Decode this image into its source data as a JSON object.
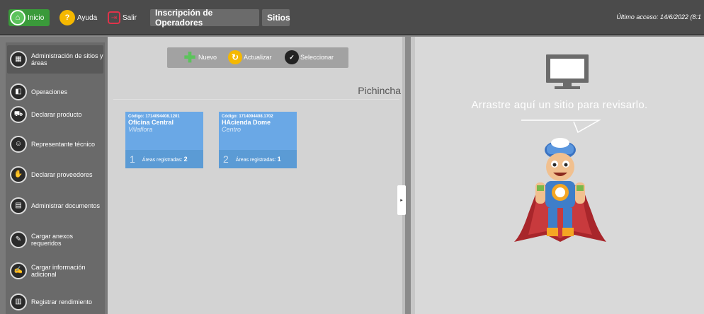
{
  "topbar": {
    "inicio": "Inicio",
    "ayuda": "Ayuda",
    "salir": "Salir",
    "tabs": [
      "Inscripción de Operadores",
      "Sitios"
    ],
    "last_access": "Último acceso: 14/6/2022 (8:1"
  },
  "sidebar": {
    "items": [
      {
        "label": "Administración de sitios y áreas",
        "icon": "sites-icon",
        "active": true
      },
      {
        "label": "Operaciones",
        "icon": "operations-icon"
      },
      {
        "label": "Declarar producto",
        "icon": "cart-icon"
      },
      {
        "label": "Representante técnico",
        "icon": "technician-icon"
      },
      {
        "label": "Declarar proveedores",
        "icon": "suppliers-icon"
      },
      {
        "label": "Administrar documentos",
        "icon": "documents-icon"
      },
      {
        "label": "Cargar anexos requeridos",
        "icon": "attachments-icon"
      },
      {
        "label": "Cargar información adicional",
        "icon": "info-icon"
      },
      {
        "label": "Registrar rendimiento",
        "icon": "performance-icon"
      }
    ]
  },
  "toolbar": {
    "nuevo": "Nuevo",
    "actualizar": "Actualizar",
    "seleccionar": "Seleccionar"
  },
  "region": "Pichincha",
  "sites": [
    {
      "code": "Código: 1714094408.1201",
      "name": "Oficina Central",
      "city": "Villaflora",
      "index": "1",
      "areas_label": "Áreas registradas:",
      "areas": "2"
    },
    {
      "code": "Código: 1714094408.1702",
      "name": "HAcienda Dome",
      "city": "Centro",
      "index": "2",
      "areas_label": "Áreas registradas:",
      "areas": "1"
    }
  ],
  "review": {
    "hint": "Arrastre aquí un sitio para revisarlo."
  },
  "colors": {
    "topbar": "#4b4b4b",
    "card": "#5b9bd5",
    "accent_green": "#5cc35c",
    "accent_yellow": "#f5b800"
  }
}
